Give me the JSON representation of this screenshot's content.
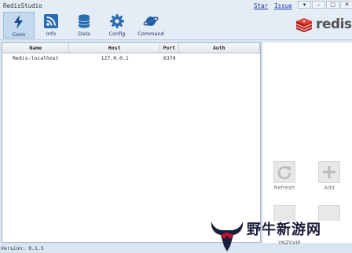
{
  "window": {
    "title": "RedisStudio",
    "links": [
      "Star",
      "Issue"
    ]
  },
  "toolbar": {
    "buttons": [
      {
        "label": "Conn",
        "icon": "lightning-icon"
      },
      {
        "label": "Info",
        "icon": "rss-icon"
      },
      {
        "label": "Data",
        "icon": "database-icon"
      },
      {
        "label": "Config",
        "icon": "gear-icon"
      },
      {
        "label": "Command",
        "icon": "planet-icon"
      }
    ]
  },
  "logo": {
    "text": "redis"
  },
  "table": {
    "headers": [
      "Name",
      "Host",
      "Port",
      "Auth"
    ],
    "rows": [
      {
        "name": "Redis-localhost",
        "host": "127.0.0.1",
        "port": "6379",
        "auth": ""
      }
    ]
  },
  "actions": {
    "refresh": "Refresh",
    "add": "Add"
  },
  "status": {
    "version": "Version: 0.1.5"
  },
  "watermark": {
    "title": "野牛新游网",
    "url": "YNZY.VIP"
  },
  "colors": {
    "accent": "#c3d9ee",
    "link": "#1a3d9e",
    "redis_red": "#d82c20"
  }
}
